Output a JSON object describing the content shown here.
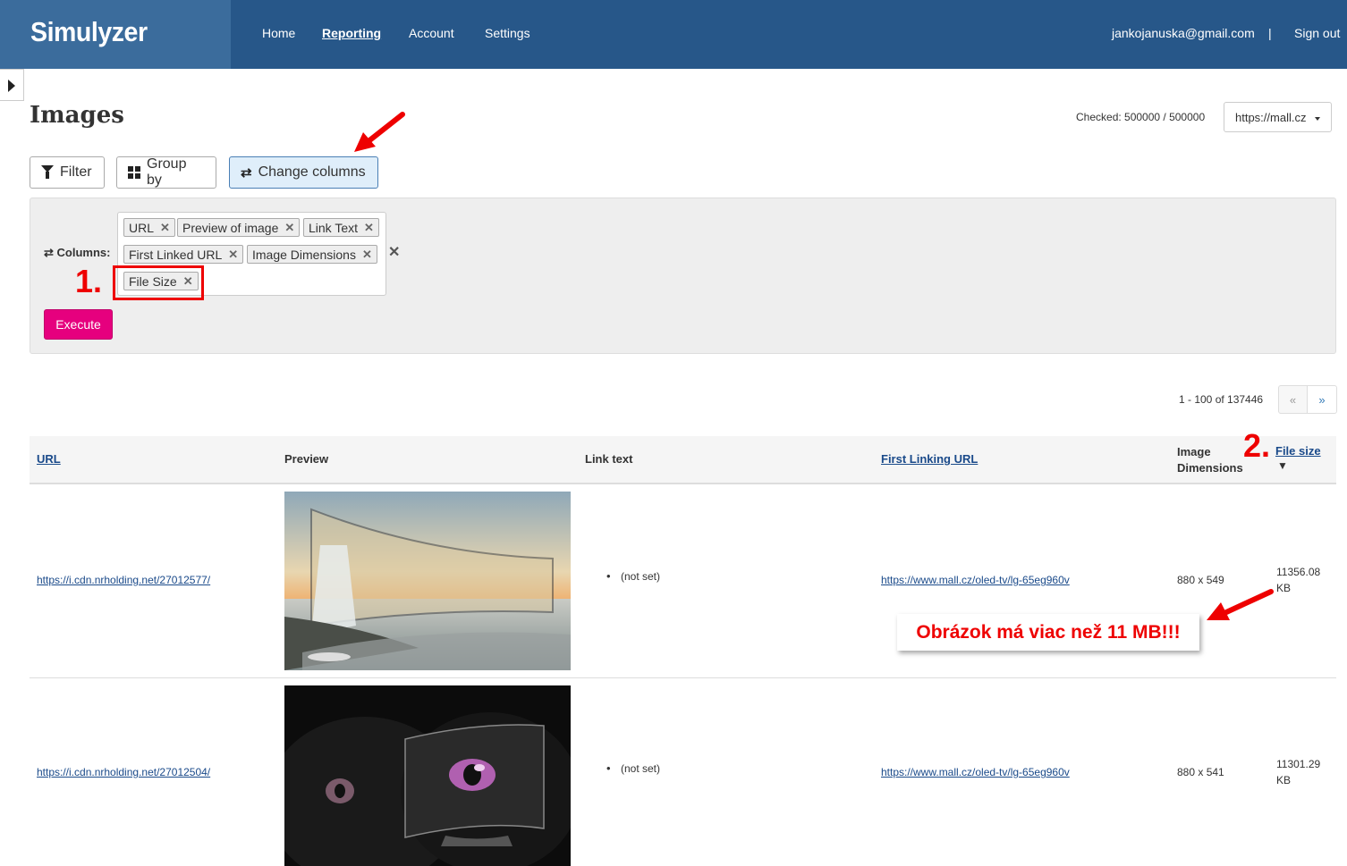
{
  "header": {
    "logo": "Simulyzer",
    "nav": [
      "Home",
      "Reporting",
      "Account",
      "Settings"
    ],
    "active_nav": "Reporting",
    "user_email": "jankojanuska@gmail.com",
    "separator": "|",
    "sign_out": "Sign out"
  },
  "page": {
    "title": "Images",
    "checked_label": "Checked: 500000 / 500000",
    "site_select": "https://mall.cz"
  },
  "toolbar": {
    "filter": "Filter",
    "group_by": "Group by",
    "change_columns": "Change columns"
  },
  "columns_panel": {
    "label": "Columns:",
    "tags": [
      "URL",
      "Preview of image",
      "Link Text",
      "First Linked URL",
      "Image Dimensions",
      "File Size"
    ],
    "execute": "Execute"
  },
  "annotations": {
    "step1": "1.",
    "step2": "2.",
    "callout": "Obrázok má viac než 11 MB!!!"
  },
  "pagination": {
    "range": "1 - 100 of 137446",
    "prev": "«",
    "next": "»"
  },
  "table": {
    "headers": {
      "url": "URL",
      "preview": "Preview",
      "link_text": "Link text",
      "first_linking_url": "First Linking URL",
      "image_dimensions": "Image Dimensions",
      "file_size": "File size",
      "sort_indicator": "▼"
    },
    "rows": [
      {
        "url": "https://i.cdn.nrholding.net/27012577/",
        "link_text": "(not set)",
        "first_linking_url": "https://www.mall.cz/oled-tv/lg-65eg960v",
        "dimensions": "880 x 549",
        "file_size_value": "11356.08",
        "file_size_unit": "KB"
      },
      {
        "url": "https://i.cdn.nrholding.net/27012504/",
        "link_text": "(not set)",
        "first_linking_url": "https://www.mall.cz/oled-tv/lg-65eg960v",
        "dimensions": "880 x 541",
        "file_size_value": "11301.29",
        "file_size_unit": "KB"
      }
    ]
  },
  "colors": {
    "header_bg": "#275789",
    "logo_bg": "#3b6c9c",
    "execute_bg": "#e6007e",
    "annotation_red": "#ee0000",
    "link": "#1a4a8a"
  }
}
